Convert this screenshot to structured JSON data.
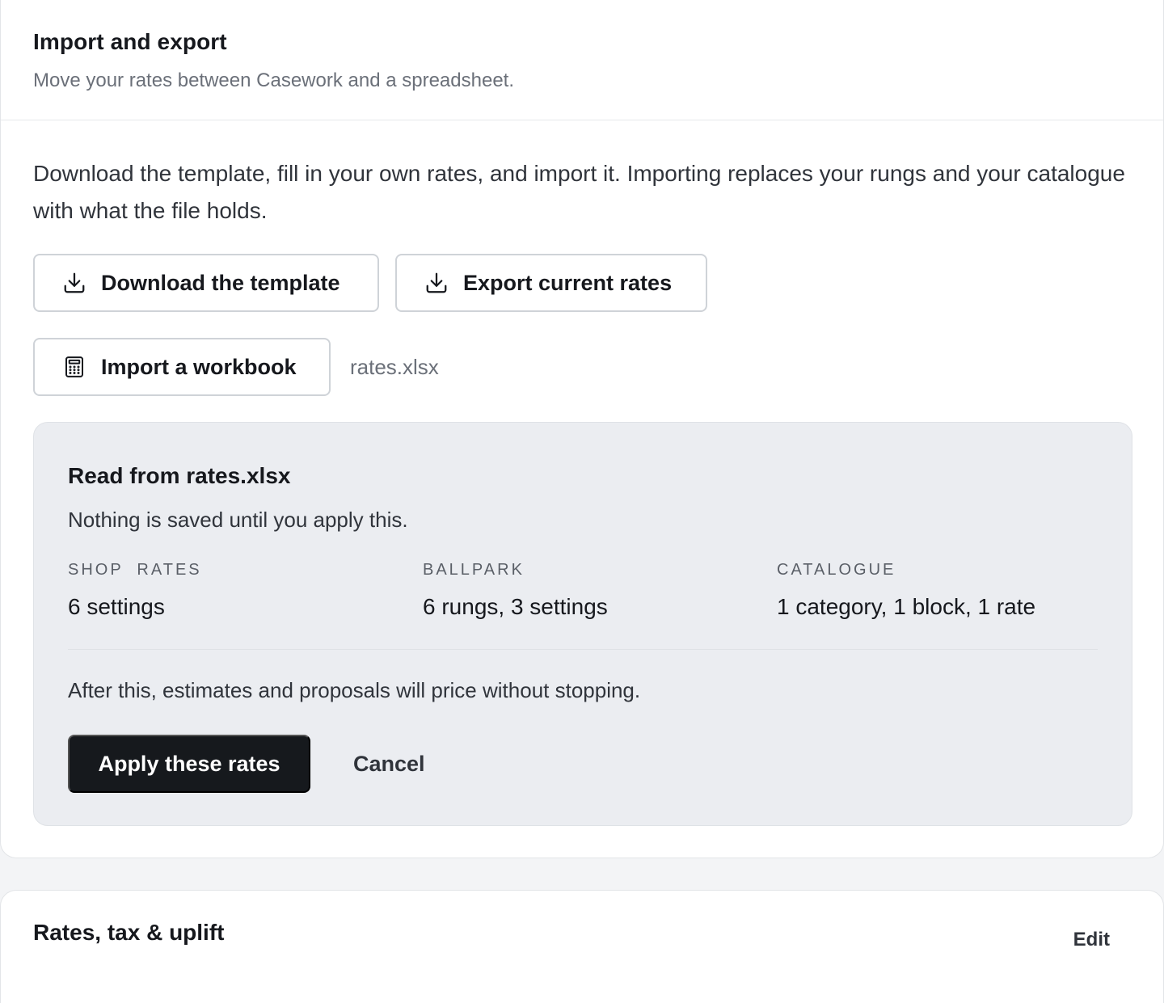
{
  "import_export": {
    "title": "Import and export",
    "subtitle": "Move your rates between Casework and a spreadsheet.",
    "intro": "Download the template, fill in your own rates, and import it. Importing replaces your rungs and your catalogue with what the file holds.",
    "download_template_label": "Download the template",
    "export_rates_label": "Export current rates",
    "import_workbook_label": "Import a workbook",
    "selected_file": "rates.xlsx",
    "icons": {
      "download": "download-icon",
      "export": "download-icon",
      "import": "spreadsheet-icon"
    },
    "preview": {
      "title": "Read from rates.xlsx",
      "note": "Nothing is saved until you apply this.",
      "stats": [
        {
          "label": "SHOP  RATES",
          "value": "6 settings"
        },
        {
          "label": "BALLPARK",
          "value": "6 rungs, 3 settings"
        },
        {
          "label": "CATALOGUE",
          "value": "1 category, 1 block, 1 rate"
        }
      ],
      "after_note": "After this, estimates and proposals will price without stopping.",
      "apply_label": "Apply these rates",
      "cancel_label": "Cancel"
    }
  },
  "rates_section": {
    "title": "Rates, tax & uplift",
    "edit_label": "Edit"
  },
  "colors": {
    "page_background": "#f3f4f6",
    "card_background": "#ffffff",
    "preview_background": "#ebedf1",
    "primary_button": "#16191d",
    "muted_text": "#6b7079"
  }
}
